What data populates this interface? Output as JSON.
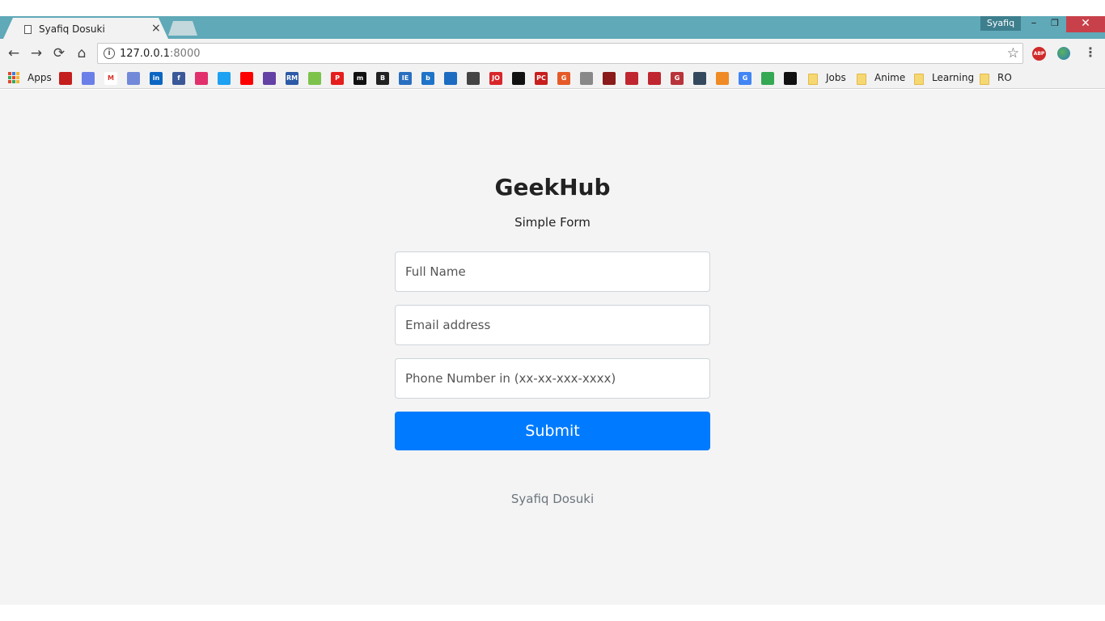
{
  "browser": {
    "tab": {
      "title": "Syafiq Dosuki",
      "close_glyph": "×"
    },
    "profile": "Syafiq",
    "window_controls": {
      "minimize": "–",
      "maximize": "❐",
      "close": "✕"
    },
    "nav": {
      "back": "←",
      "forward": "→",
      "reload": "⟳",
      "home": "⌂"
    },
    "url": {
      "host": "127.0.0.1",
      "port": ":8000"
    },
    "info_glyph": "i",
    "star_glyph": "☆",
    "abp_label": "ABP",
    "menu_glyph": "⋮"
  },
  "bookmarks": {
    "apps_label": "Apps",
    "favicons": [
      {
        "name": "bookmark-1",
        "color": "#c41e1e"
      },
      {
        "name": "mail",
        "color": "#6b7fe8"
      },
      {
        "name": "gmail",
        "color": "#ffffff",
        "glyph": "M",
        "fg": "#d93025"
      },
      {
        "name": "discord",
        "color": "#7289da"
      },
      {
        "name": "linkedin",
        "color": "#0a66c2",
        "glyph": "in"
      },
      {
        "name": "facebook",
        "color": "#3b5998",
        "glyph": "f"
      },
      {
        "name": "instagram",
        "color": "#e1306c"
      },
      {
        "name": "twitter",
        "color": "#1da1f2"
      },
      {
        "name": "youtube",
        "color": "#ff0000"
      },
      {
        "name": "twitch",
        "color": "#6441a5"
      },
      {
        "name": "rm",
        "color": "#2d5aa6",
        "glyph": "RM"
      },
      {
        "name": "green-bug",
        "color": "#7dc24b"
      },
      {
        "name": "p-red",
        "color": "#e61d1d",
        "glyph": "P"
      },
      {
        "name": "m-black",
        "color": "#111111",
        "glyph": "m"
      },
      {
        "name": "b-black",
        "color": "#222222",
        "glyph": "B"
      },
      {
        "name": "ie-blue",
        "color": "#2a6fbf",
        "glyph": "IE"
      },
      {
        "name": "b-blue",
        "color": "#1e74c8",
        "glyph": "b"
      },
      {
        "name": "wave-blue",
        "color": "#1c6cc1"
      },
      {
        "name": "chat-grey",
        "color": "#444444"
      },
      {
        "name": "jo-red",
        "color": "#d8262a",
        "glyph": "JO"
      },
      {
        "name": "ball-black",
        "color": "#111111"
      },
      {
        "name": "pc-red",
        "color": "#c81e1e",
        "glyph": "PC"
      },
      {
        "name": "g-orange",
        "color": "#e55b28",
        "glyph": "G"
      },
      {
        "name": "diamond-grey",
        "color": "#888888"
      },
      {
        "name": "spider-red",
        "color": "#8b1a1a"
      },
      {
        "name": "gamepad-1",
        "color": "#c0262f"
      },
      {
        "name": "gamepad-2",
        "color": "#c0262f"
      },
      {
        "name": "g-red",
        "color": "#b8343a",
        "glyph": "G"
      },
      {
        "name": "cluster-dark",
        "color": "#34495e"
      },
      {
        "name": "orange-grid",
        "color": "#f08a24"
      },
      {
        "name": "translate",
        "color": "#4285f4",
        "glyph": "G"
      },
      {
        "name": "drive",
        "color": "#34a853"
      },
      {
        "name": "github",
        "color": "#111111"
      }
    ],
    "folders": [
      "Jobs",
      "Anime",
      "Learning",
      "RO"
    ]
  },
  "page": {
    "title": "GeekHub",
    "subtitle": "Simple Form",
    "fields": {
      "full_name_placeholder": "Full Name",
      "email_placeholder": "Email address",
      "phone_placeholder": "Phone Number in (xx-xx-xxx-xxxx)"
    },
    "submit_label": "Submit",
    "footer": "Syafiq Dosuki"
  }
}
